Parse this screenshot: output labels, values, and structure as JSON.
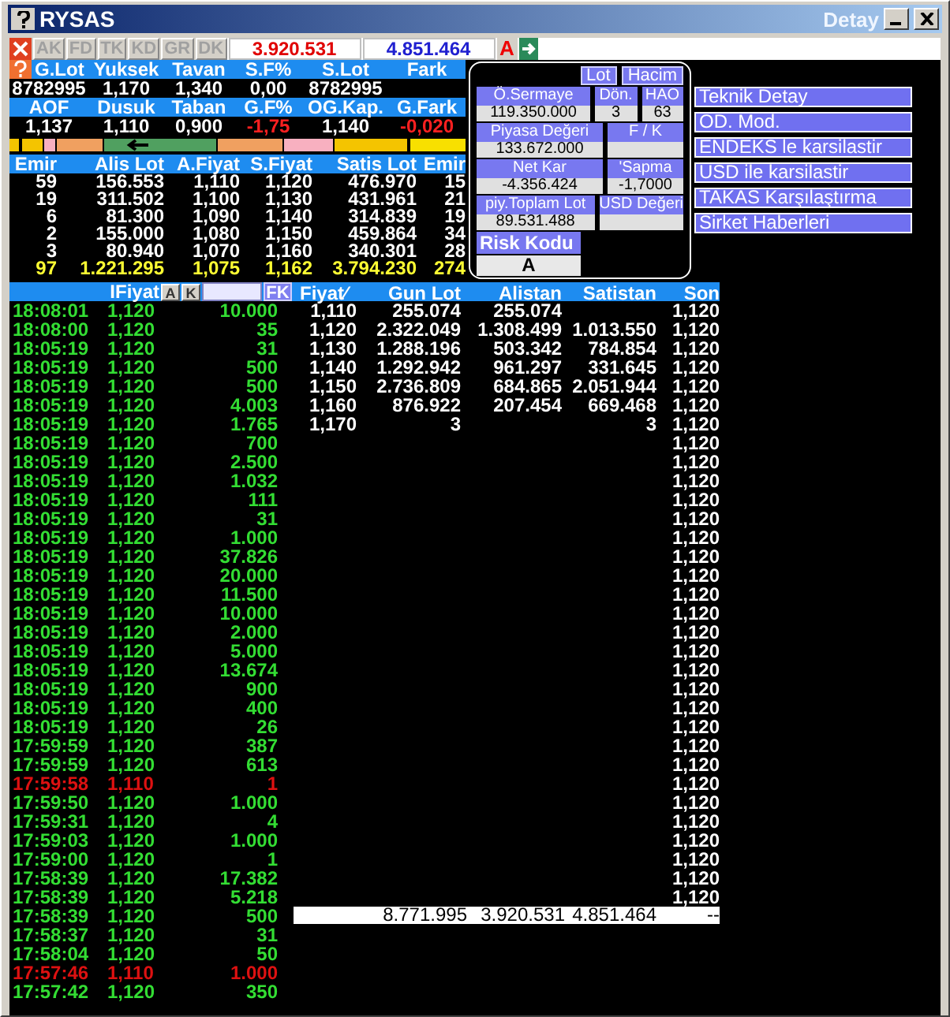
{
  "window": {
    "title": "RYSAS",
    "subtitle": "Detay"
  },
  "toolbar": {
    "tabs": [
      "AK",
      "FD",
      "TK",
      "KD",
      "GR",
      "DK"
    ],
    "bid_total": "3.920.531",
    "ask_total": "4.851.464",
    "flag": "A"
  },
  "summary": [
    {
      "headers": [
        "G.Lot",
        "Yuksek",
        "Tavan",
        "S.F%",
        "S.Lot",
        "Fark"
      ],
      "values": [
        {
          "text": "8782995",
          "negative": false
        },
        {
          "text": "1,170",
          "negative": false
        },
        {
          "text": "1,340",
          "negative": false
        },
        {
          "text": "0,00",
          "negative": false
        },
        {
          "text": "8782995",
          "negative": false
        }
      ]
    },
    {
      "headers": [
        "AOF",
        "Dusuk",
        "Taban",
        "G.F%",
        "OG.Kap.",
        "G.Fark"
      ],
      "values": [
        {
          "text": "1,137",
          "negative": false
        },
        {
          "text": "1,110",
          "negative": false
        },
        {
          "text": "0,900",
          "negative": false
        },
        {
          "text": "-1,75",
          "negative": true
        },
        {
          "text": "1,140",
          "negative": false
        },
        {
          "text": "-0,020",
          "negative": true
        }
      ]
    }
  ],
  "depth": {
    "columns": [
      "Emir",
      "Alis Lot",
      "A.Fiyat",
      "S.Fiyat",
      "Satis Lot",
      "Emir"
    ],
    "rows": [
      [
        "59",
        "156.553",
        "1,110",
        "1,120",
        "476.970",
        "15"
      ],
      [
        "19",
        "311.502",
        "1,100",
        "1,130",
        "431.961",
        "21"
      ],
      [
        "6",
        "81.300",
        "1,090",
        "1,140",
        "314.839",
        "19"
      ],
      [
        "2",
        "155.000",
        "1,080",
        "1,150",
        "459.864",
        "34"
      ],
      [
        "3",
        "80.940",
        "1,070",
        "1,160",
        "340.301",
        "28"
      ]
    ],
    "total": [
      "97",
      "1.221.295",
      "1,075",
      "1,162",
      "3.794.230",
      "274"
    ]
  },
  "stats_panel": {
    "toggles": [
      "Lot",
      "Hacim"
    ],
    "rows": [
      [
        {
          "label": "Ö.Sermaye",
          "value": "119.350.000"
        },
        {
          "label": "Dön.",
          "value": "3"
        },
        {
          "label": "HAO",
          "value": "63"
        }
      ],
      [
        {
          "label": "Piyasa Değeri",
          "value": "133.672.000"
        },
        {
          "label": "F / K"
        }
      ],
      [
        {
          "label": "Net Kar",
          "value": "-4.356.424"
        },
        {
          "label": "'Sapma",
          "value": "-1,7000"
        }
      ],
      [
        {
          "label": "piy.Toplam Lot",
          "value": "89.531.488"
        },
        {
          "label": "USD Değeri"
        }
      ]
    ],
    "risk": {
      "label": "Risk Kodu",
      "value": "A"
    }
  },
  "actions": [
    "Teknik Detay",
    "OD. Mod.",
    "ENDEKS le karsilastir",
    "USD ile karsilastir",
    "TAKAS Karşılaştırma",
    "Sirket Haberleri"
  ],
  "trades": {
    "header": "IFiyat",
    "buttons": [
      "A",
      "K"
    ],
    "filter_button": "FK",
    "rows": [
      {
        "time": "18:08:01",
        "price": "1,120",
        "lot": "10.000",
        "down": false
      },
      {
        "time": "18:08:00",
        "price": "1,120",
        "lot": "35",
        "down": false
      },
      {
        "time": "18:05:19",
        "price": "1,120",
        "lot": "31",
        "down": false
      },
      {
        "time": "18:05:19",
        "price": "1,120",
        "lot": "500",
        "down": false
      },
      {
        "time": "18:05:19",
        "price": "1,120",
        "lot": "500",
        "down": false
      },
      {
        "time": "18:05:19",
        "price": "1,120",
        "lot": "4.003",
        "down": false
      },
      {
        "time": "18:05:19",
        "price": "1,120",
        "lot": "1.765",
        "down": false
      },
      {
        "time": "18:05:19",
        "price": "1,120",
        "lot": "700",
        "down": false
      },
      {
        "time": "18:05:19",
        "price": "1,120",
        "lot": "2.500",
        "down": false
      },
      {
        "time": "18:05:19",
        "price": "1,120",
        "lot": "1.032",
        "down": false
      },
      {
        "time": "18:05:19",
        "price": "1,120",
        "lot": "111",
        "down": false
      },
      {
        "time": "18:05:19",
        "price": "1,120",
        "lot": "31",
        "down": false
      },
      {
        "time": "18:05:19",
        "price": "1,120",
        "lot": "1.000",
        "down": false
      },
      {
        "time": "18:05:19",
        "price": "1,120",
        "lot": "37.826",
        "down": false
      },
      {
        "time": "18:05:19",
        "price": "1,120",
        "lot": "20.000",
        "down": false
      },
      {
        "time": "18:05:19",
        "price": "1,120",
        "lot": "11.500",
        "down": false
      },
      {
        "time": "18:05:19",
        "price": "1,120",
        "lot": "10.000",
        "down": false
      },
      {
        "time": "18:05:19",
        "price": "1,120",
        "lot": "2.000",
        "down": false
      },
      {
        "time": "18:05:19",
        "price": "1,120",
        "lot": "5.000",
        "down": false
      },
      {
        "time": "18:05:19",
        "price": "1,120",
        "lot": "13.674",
        "down": false
      },
      {
        "time": "18:05:19",
        "price": "1,120",
        "lot": "900",
        "down": false
      },
      {
        "time": "18:05:19",
        "price": "1,120",
        "lot": "400",
        "down": false
      },
      {
        "time": "18:05:19",
        "price": "1,120",
        "lot": "26",
        "down": false
      },
      {
        "time": "17:59:59",
        "price": "1,120",
        "lot": "387",
        "down": false
      },
      {
        "time": "17:59:59",
        "price": "1,120",
        "lot": "613",
        "down": false
      },
      {
        "time": "17:59:58",
        "price": "1,110",
        "lot": "1",
        "down": true
      },
      {
        "time": "17:59:50",
        "price": "1,120",
        "lot": "1.000",
        "down": false
      },
      {
        "time": "17:59:31",
        "price": "1,120",
        "lot": "4",
        "down": false
      },
      {
        "time": "17:59:03",
        "price": "1,120",
        "lot": "1.000",
        "down": false
      },
      {
        "time": "17:59:00",
        "price": "1,120",
        "lot": "1",
        "down": false
      },
      {
        "time": "17:58:39",
        "price": "1,120",
        "lot": "17.382",
        "down": false
      },
      {
        "time": "17:58:39",
        "price": "1,120",
        "lot": "5.218",
        "down": false
      },
      {
        "time": "17:58:39",
        "price": "1,120",
        "lot": "500",
        "down": false
      },
      {
        "time": "17:58:37",
        "price": "1,120",
        "lot": "31",
        "down": false
      },
      {
        "time": "17:58:04",
        "price": "1,120",
        "lot": "50",
        "down": false
      },
      {
        "time": "17:57:46",
        "price": "1,110",
        "lot": "1.000",
        "down": true
      },
      {
        "time": "17:57:42",
        "price": "1,120",
        "lot": "350",
        "down": false
      }
    ]
  },
  "price_table": {
    "columns": [
      "Fiyat∕",
      "Gun Lot",
      "Alistan",
      "Satistan",
      "Son"
    ],
    "rows": [
      [
        "1,110",
        "255.074",
        "255.074",
        ""
      ],
      [
        "1,120",
        "2.322.049",
        "1.308.499",
        "1.013.550"
      ],
      [
        "1,130",
        "1.288.196",
        "503.342",
        "784.854"
      ],
      [
        "1,140",
        "1.292.942",
        "961.297",
        "331.645"
      ],
      [
        "1,150",
        "2.736.809",
        "684.865",
        "2.051.944"
      ],
      [
        "1,160",
        "876.922",
        "207.454",
        "669.468"
      ],
      [
        "1,170",
        "3",
        "",
        "3"
      ]
    ],
    "son": [
      "1,120",
      "1,120",
      "1,120",
      "1,120",
      "1,120",
      "1,120",
      "1,120",
      "1,120",
      "1,120",
      "1,120",
      "1,120",
      "1,120",
      "1,120",
      "1,120",
      "1,120",
      "1,120",
      "1,120",
      "1,120",
      "1,120",
      "1,120",
      "1,120",
      "1,120",
      "1,120",
      "1,120",
      "1,120",
      "1,120",
      "1,120",
      "1,120",
      "1,120",
      "1,120",
      "1,120",
      "1,120"
    ],
    "totals": [
      "8.771.995",
      "3.920.531",
      "4.851.464",
      "--"
    ]
  }
}
